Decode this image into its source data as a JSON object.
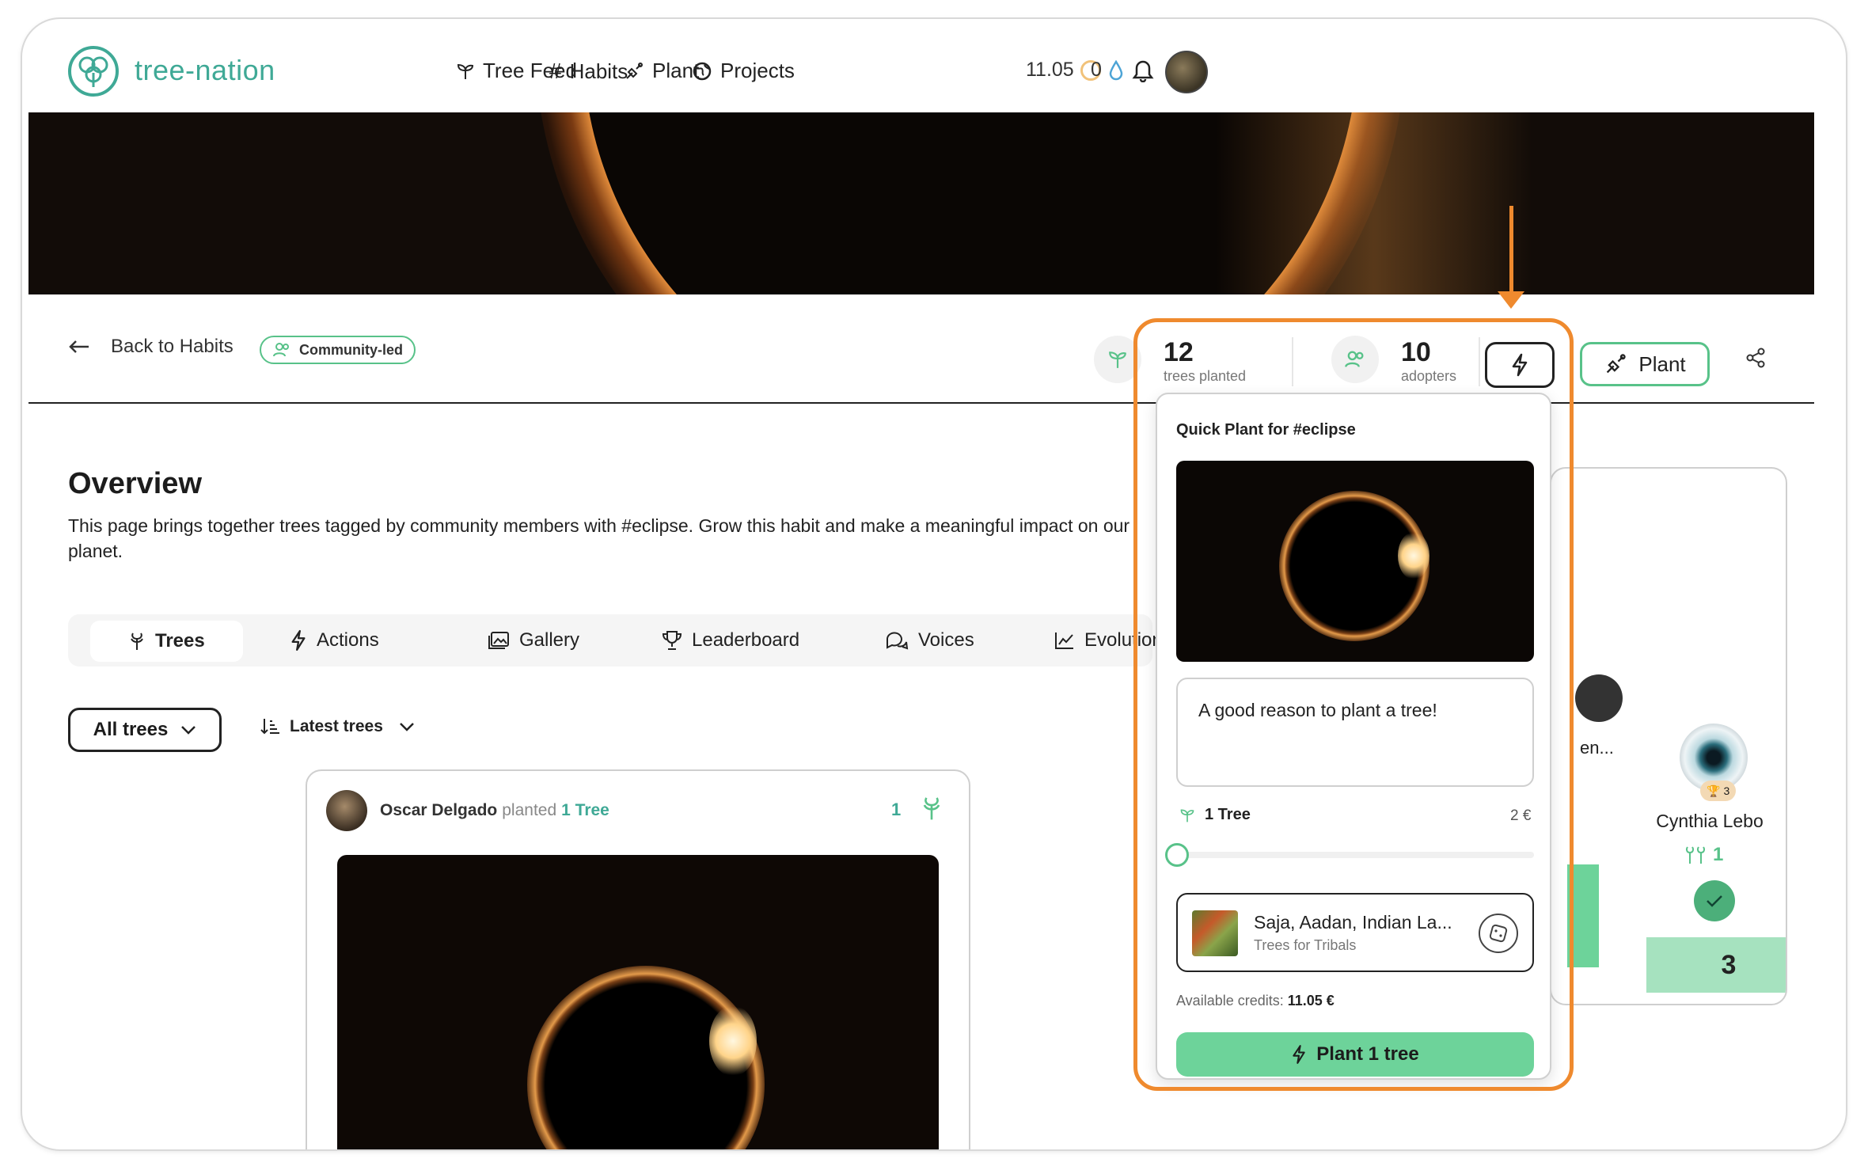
{
  "header": {
    "logo_text": "tree-nation",
    "nav": [
      {
        "label": "Tree Feed",
        "icon": "sprout-icon"
      },
      {
        "label": "Habits",
        "icon": "hashtag-icon"
      },
      {
        "label": "Plant",
        "icon": "shovel-icon"
      },
      {
        "label": "Projects",
        "icon": "globe-icon"
      }
    ],
    "credits": "11.05",
    "drops": "0"
  },
  "subheader": {
    "back_label": "Back to Habits",
    "pill_label": "Community-led",
    "trees_planted_num": "12",
    "trees_planted_label": "trees planted",
    "adopters_num": "10",
    "adopters_label": "adopters",
    "plant_label": "Plant"
  },
  "overview": {
    "title": "Overview",
    "text": "This page brings together trees tagged by community members with #eclipse. Grow this habit and make a meaningful impact on our planet."
  },
  "tabs": [
    {
      "label": "Trees",
      "icon": "tree-icon",
      "active": true
    },
    {
      "label": "Actions",
      "icon": "lightning-icon"
    },
    {
      "label": "Gallery",
      "icon": "gallery-icon"
    },
    {
      "label": "Leaderboard",
      "icon": "trophy-icon"
    },
    {
      "label": "Voices",
      "icon": "chat-icon"
    },
    {
      "label": "Evolution",
      "icon": "chart-icon"
    }
  ],
  "filters": {
    "select_label": "All trees",
    "sort_label": "Latest trees"
  },
  "feed_card": {
    "user_name": "Oscar Delgado",
    "action": "planted",
    "tree_link": "1 Tree",
    "count": "1"
  },
  "leaderboard": {
    "name_partial": "en...",
    "name": "Cynthia Lebo",
    "badge": "3",
    "tree_count": "1",
    "rank": "3"
  },
  "quick_plant": {
    "title": "Quick Plant for #eclipse",
    "message_placeholder": "A good reason to plant a tree!",
    "trees_label": "1 Tree",
    "price": "2 €",
    "slider_value": 0,
    "project_name": "Saja, Aadan, Indian La...",
    "project_org": "Trees for Tribals",
    "credits_prefix": "Available credits: ",
    "credits_value": "11.05 €",
    "button_label": "Plant 1 tree"
  },
  "colors": {
    "brand": "#3fa996",
    "accent": "#58c289",
    "highlight": "#ef8a2e"
  }
}
